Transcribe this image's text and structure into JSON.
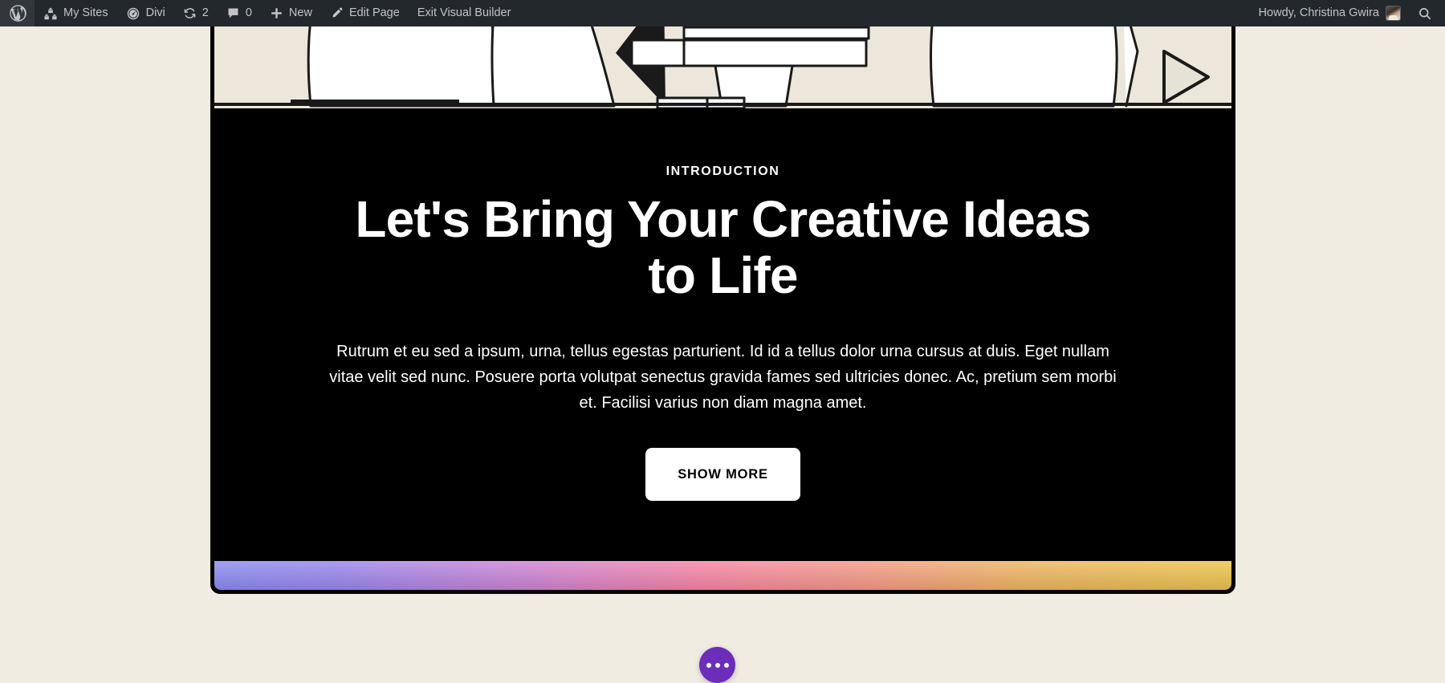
{
  "admin_bar": {
    "background_color": "#23282d",
    "left_items": [
      {
        "id": "wp-logo",
        "icon": "wordpress-logo-icon",
        "label": ""
      },
      {
        "id": "my-sites",
        "icon": "buildings-icon",
        "label": "My Sites"
      },
      {
        "id": "divi",
        "icon": "speedometer-icon",
        "label": "Divi"
      },
      {
        "id": "updates",
        "icon": "update-arrows-icon",
        "label": "2"
      },
      {
        "id": "comments",
        "icon": "comment-bubble-icon",
        "label": "0"
      },
      {
        "id": "new-content",
        "icon": "plus-icon",
        "label": "New"
      },
      {
        "id": "edit-page",
        "icon": "pencil-icon",
        "label": "Edit Page"
      },
      {
        "id": "exit-visual-builder",
        "icon": "",
        "label": "Exit Visual Builder"
      }
    ],
    "right_items": {
      "howdy": "Howdy, Christina Gwira",
      "avatar": "user-avatar",
      "search": "search-icon"
    }
  },
  "page": {
    "background_color": "#f0ece2",
    "illustration": {
      "name": "person-at-desk-line-art",
      "background_color": "#ece7da"
    },
    "section": {
      "background_color": "#000000",
      "border_color": "#000000",
      "eyebrow": "INTRODUCTION",
      "headline": "Let's Bring Your Creative Ideas to Life",
      "body": "Rutrum et eu sed a ipsum, urna, tellus egestas parturient. Id id a tellus dolor urna cursus at duis. Eget nullam vitae velit sed nunc. Posuere porta volutpat senectus gravida fames sed ultricies donec. Ac, pretium sem morbi et. Facilisi varius non diam magna amet.",
      "cta_label": "SHOW MORE",
      "cta_background": "#ffffff",
      "cta_text_color": "#000000"
    },
    "gradient_bar": {
      "start_color": "#8a8cf0",
      "mid_color": "#f785a6",
      "end_color": "#ecc44d"
    },
    "floating_button": {
      "name": "divi-builder-menu",
      "color": "#6c2eb9",
      "icon": "three-dots-icon"
    }
  }
}
